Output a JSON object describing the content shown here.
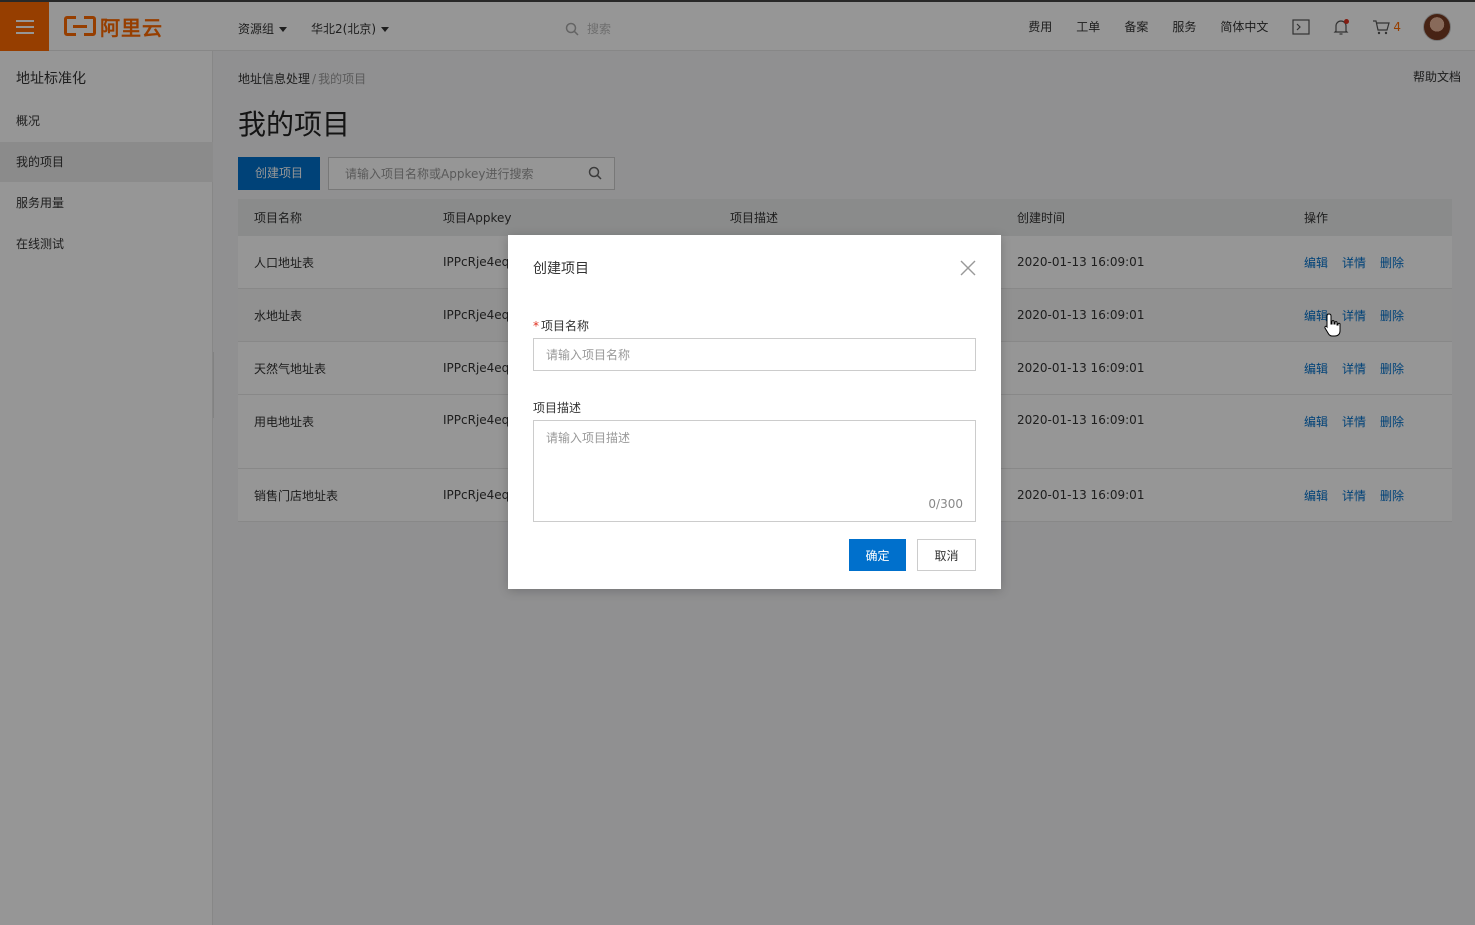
{
  "topbar": {
    "logo_text": "阿里云",
    "resource_group": "资源组",
    "region": "华北2(北京)",
    "search_placeholder": "搜索",
    "links": [
      "费用",
      "工单",
      "备案",
      "服务",
      "简体中文"
    ],
    "cart_count": "4",
    "accent_color": "#ff6a00"
  },
  "sidebar": {
    "title": "地址标准化",
    "items": [
      {
        "label": "概况"
      },
      {
        "label": "我的项目",
        "active": true
      },
      {
        "label": "服务用量"
      },
      {
        "label": "在线测试"
      }
    ]
  },
  "main": {
    "breadcrumb": {
      "parent": "地址信息处理",
      "current": "我的项目"
    },
    "help_doc": "帮助文档",
    "title": "我的项目",
    "create_button": "创建项目",
    "search_placeholder": "请输入项目名称或Appkey进行搜索",
    "table": {
      "headers": [
        "项目名称",
        "项目Appkey",
        "项目描述",
        "创建时间",
        "操作"
      ],
      "actions": [
        "编辑",
        "详情",
        "删除"
      ],
      "rows": [
        {
          "name": "人口地址表",
          "appkey": "IPPcRje4eq",
          "desc": "",
          "time": "2020-01-13  16:09:01"
        },
        {
          "name": "水地址表",
          "appkey": "IPPcRje4eq",
          "desc": "",
          "time": "2020-01-13  16:09:01"
        },
        {
          "name": "天然气地址表",
          "appkey": "IPPcRje4eq",
          "desc": "",
          "time": "2020-01-13  16:09:01"
        },
        {
          "name": "用电地址表",
          "appkey": "IPPcRje4eq",
          "desc": "",
          "time": "2020-01-13  16:09:01"
        },
        {
          "name": "销售门店地址表",
          "appkey": "IPPcRje4eq",
          "desc": "",
          "time": "2020-01-13  16:09:01"
        }
      ]
    }
  },
  "modal": {
    "title": "创建项目",
    "name_label": "项目名称",
    "name_required_mark": "*",
    "name_placeholder": "请输入项目名称",
    "desc_label": "项目描述",
    "desc_placeholder": "请输入项目描述",
    "desc_counter": "0/300",
    "ok_button": "确定",
    "cancel_button": "取消",
    "primary_color": "#0070cc"
  }
}
